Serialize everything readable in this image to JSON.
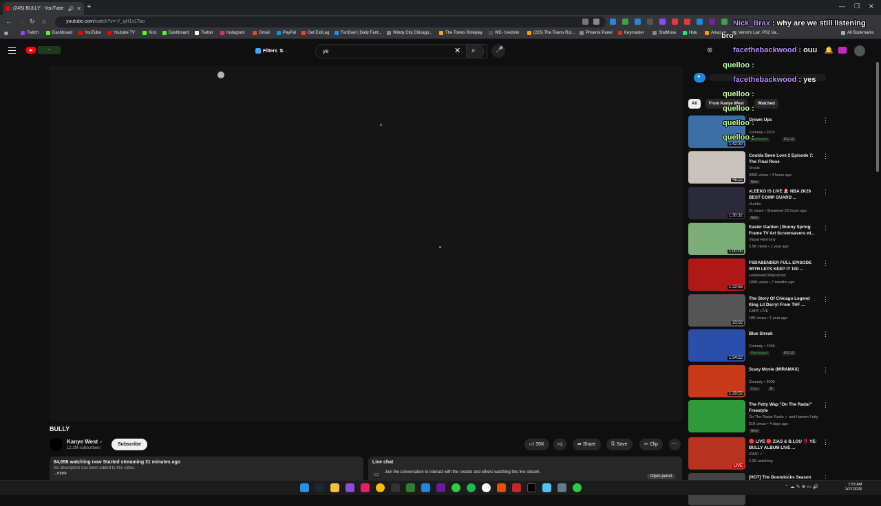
{
  "browser": {
    "tab_title": "(245) BULLY - YouTube",
    "url_host": "youtube.com",
    "url_rest": "/watch?v=-Y_qH1s1Tao",
    "bookmarks": [
      "Twitch",
      "Dashboard",
      "YouTube",
      "Youtube TV",
      "Kick",
      "Dashboard",
      "Twitter",
      "Instagram",
      "Gmail",
      "PayPal",
      "Get ExitLag",
      "FanDuel | Daily Fant...",
      "Windy City Chicago...",
      "The Towns Roleplay",
      "WC- txAdmin",
      "(225) The Towns Rol...",
      "Phoenix Panel",
      "Keymaster",
      "StatMuse",
      "Hulu",
      "Amazon",
      "Venm's Lair: PS2 Va..."
    ],
    "all_bookmarks": "All Bookmarks",
    "bookmark_colors": [
      "#9146ff",
      "#53fc18",
      "#ff0000",
      "#ff0000",
      "#53fc18",
      "#53fc18",
      "#fff",
      "#e1306c",
      "#ea4335",
      "#009cde",
      "#ff3b30",
      "#1493ff",
      "#888",
      "#f6a623",
      "#555",
      "#ff9900",
      "#888",
      "#d93025",
      "#888",
      "#1ce783",
      "#ff9900",
      "#888"
    ]
  },
  "youtube": {
    "filters_label": "Filters",
    "search_value": "ye",
    "video_title": "BULLY",
    "channel_name": "Kanye West",
    "channel_subs": "12.2M subscribers",
    "subscribe_label": "Subscribe",
    "likes": "35K",
    "share_label": "Share",
    "save_label": "Save",
    "clip_label": "Clip",
    "desc_line1": "64,658 watching now  Started streaming 31 minutes ago",
    "desc_line2": "No description has been added to this video.",
    "desc_more": "...more",
    "live_chat_title": "Live chat",
    "live_chat_msg": "Join the conversation to interact with the creator and others watching this live stream.",
    "open_panel": "Open panel",
    "chips": [
      "All",
      "From Kanye West",
      "Watched"
    ],
    "recommendations": [
      {
        "title": "Grown Ups",
        "meta1": "Comedy • 2010",
        "badges": [
          "Purchased",
          "PG-13"
        ],
        "duration": "1:42:30",
        "thumb": "#3a6ea5"
      },
      {
        "title": "Coulda Been Love 2 Episode 7: The Final Rose",
        "meta1": "Druski",
        "meta2": "936K views • 4 hours ago",
        "badges": [
          "New"
        ],
        "duration": "48:22",
        "thumb": "#c9c2bc"
      },
      {
        "title": "vLEEKO IS LIVE 🚨 NBA 2K26 BEST COMP GUARD ...",
        "meta1": "vLeeko",
        "meta2": "21 views • Streamed 23 hours ago",
        "badges": [
          "New"
        ],
        "duration": "1:30:32",
        "thumb": "#2a2a3a"
      },
      {
        "title": "Easter Garden | Bunny Spring Frame TV Art Screensavers wi...",
        "meta1": "Visual Harmony",
        "meta2": "3.5K views • 1 year ago",
        "badges": [],
        "duration": "1:00:00",
        "thumb": "#7cae7a"
      },
      {
        "title": "FSDABENDER FULL EPISODE WITH LETS KEEP IT 100 ...",
        "meta1": "Letskeepit100podcast",
        "meta2": "189K views • 7 months ago",
        "badges": [],
        "duration": "1:22:55",
        "thumb": "#b01818"
      },
      {
        "title": "The Story Of Chicago Legend King Lil Darryl From THF ...",
        "meta1": "CAPP LIVE",
        "meta2": "18K views • 1 year ago",
        "badges": [],
        "duration": "20:02",
        "thumb": "#555"
      },
      {
        "title": "Blue Streak",
        "meta1": "Comedy • 1999",
        "badges": [
          "Purchased",
          "PG-13"
        ],
        "duration": "1:34:22",
        "thumb": "#2b4ea8"
      },
      {
        "title": "Scary Movie (MIRAMAX)",
        "meta1": "Comedy • 2000",
        "badges": [
          "Free",
          "R"
        ],
        "duration": "1:29:52",
        "thumb": "#c83a1a"
      },
      {
        "title": "The Fetty Wap \"On The Radar\" Freestyle",
        "meta1": "On The Radar Radio ✓ and Harlem Fetty",
        "meta2": "51K views • 4 days ago",
        "badges": [
          "New"
        ],
        "duration": "",
        "thumb": "#2f9a3a"
      },
      {
        "title": "🔴 LIVE 🔴 ZIAS & B.LOU ‼️ YE- BULLY ALBUM LIVE ...",
        "meta1": "ZIAS! ✓",
        "meta2": "2.2K watching",
        "badges": [],
        "duration": "LIVE",
        "thumb": "#b8331f"
      },
      {
        "title": "[HOT] The Boondocks Season",
        "meta1": "",
        "badges": [],
        "duration": "",
        "thumb": "#444"
      }
    ]
  },
  "overlay_chat": [
    {
      "user": "Nick_Brax",
      "text": " : why are we still listening"
    },
    {
      "user": "",
      "text": "bro"
    },
    {
      "user": "facethebackwood",
      "text": " : ouu"
    },
    {
      "user": "quelloo",
      "text": " :"
    },
    {
      "user": "facethebackwood",
      "text": " : yes"
    },
    {
      "user": "quelloo",
      "text": " :"
    },
    {
      "user": "quelloo",
      "text": " :"
    },
    {
      "user": "quelloo",
      "text": " :"
    },
    {
      "user": "quelloo",
      "text": " :"
    }
  ],
  "clock": {
    "time": "1:53 AM",
    "date": "3/27/2026"
  }
}
